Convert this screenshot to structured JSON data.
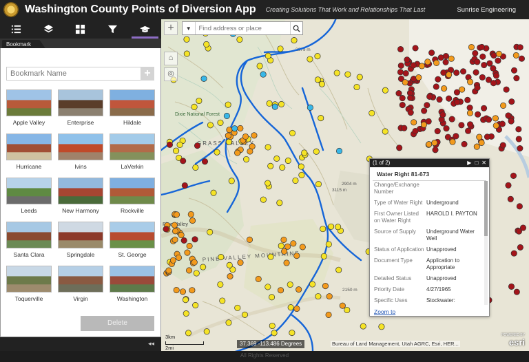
{
  "header": {
    "title": "Washington County Points of Diversion App",
    "tagline": "Creating Solutions That Work and Relationships That Last",
    "company": "Sunrise Engineering"
  },
  "toolbar": {
    "tools": [
      {
        "name": "legend-tool",
        "icon": "list-icon"
      },
      {
        "name": "layers-tool",
        "icon": "layers-icon"
      },
      {
        "name": "basemap-tool",
        "icon": "grid-icon"
      },
      {
        "name": "filter-tool",
        "icon": "filter-icon"
      },
      {
        "name": "bookmark-tool",
        "icon": "graduation-cap-icon",
        "active": true
      }
    ]
  },
  "panel": {
    "tab_label": "Bookmark",
    "input_placeholder": "Bookmark Name",
    "add_label": "+",
    "delete_label": "Delete",
    "collapse_label": "◂◂",
    "bookmarks": [
      {
        "label": "Apple Valley",
        "colors": [
          "#9fc3e6",
          "#b85a3a",
          "#6b7b3a"
        ]
      },
      {
        "label": "Enterprise",
        "colors": [
          "#a8c4dc",
          "#5a3d2a",
          "#8b8070"
        ]
      },
      {
        "label": "Hildale",
        "colors": [
          "#7fb0e0",
          "#c0563c",
          "#8a6b4a"
        ]
      },
      {
        "label": "Hurricane",
        "colors": [
          "#86b6e6",
          "#a14f35",
          "#cfc2a1"
        ]
      },
      {
        "label": "Ivins",
        "colors": [
          "#8fc1ea",
          "#c04a2a",
          "#a0826a"
        ]
      },
      {
        "label": "LaVerkin",
        "colors": [
          "#a3cbe9",
          "#b26b49",
          "#84915c"
        ]
      },
      {
        "label": "Leeds",
        "colors": [
          "#b7d3ea",
          "#5f8a43",
          "#6c6c6c"
        ]
      },
      {
        "label": "New Harmony",
        "colors": [
          "#93b9dd",
          "#a74532",
          "#4a6a3a"
        ]
      },
      {
        "label": "Rockville",
        "colors": [
          "#7fafe0",
          "#b05a38",
          "#6f8a4a"
        ]
      },
      {
        "label": "Santa Clara",
        "colors": [
          "#a6c8e4",
          "#8a4a30",
          "#6b8a55"
        ]
      },
      {
        "label": "Springdale",
        "colors": [
          "#cfd9e3",
          "#8c3a2a",
          "#9a8a6a"
        ]
      },
      {
        "label": "St. George",
        "colors": [
          "#a9cce8",
          "#b84c30",
          "#6a9048"
        ]
      },
      {
        "label": "Toquerville",
        "colors": [
          "#c8d8e6",
          "#6d7a4a",
          "#9d8b6d"
        ]
      },
      {
        "label": "Virgin",
        "colors": [
          "#b5cfe6",
          "#8a5a42",
          "#6e6e5a"
        ]
      },
      {
        "label": "Washington",
        "colors": [
          "#9bc2e6",
          "#9a4a3a",
          "#5e7a4a"
        ]
      }
    ]
  },
  "map": {
    "search_placeholder": "Find address or place",
    "zoom_in_label": "+",
    "coords": "37.369 -113.486 Degrees",
    "scale_label": "2mi",
    "scale_label_2": "3km",
    "attribution": "Bureau of Land Management, Utah AGRC, Esri, HER...",
    "esri_label": "esri",
    "esri_small": "POWERED BY",
    "place_labels": [
      {
        "text": "GRASS VALLEY"
      },
      {
        "text": "PINE VALLEY MOUNTAINS"
      },
      {
        "text": "Pine Valley"
      },
      {
        "text": "Dixie National Forest"
      },
      {
        "text": "2904 m"
      },
      {
        "text": "2150 m"
      },
      {
        "text": "3115 m"
      },
      {
        "text": "2679 m"
      }
    ]
  },
  "popup": {
    "counter": "(1 of 2)",
    "title": "Water Right 81-673",
    "zoom_label": "Zoom to",
    "attributes": [
      {
        "key": "Change/Exchange Number",
        "value": ""
      },
      {
        "key": "Type of Water Right",
        "value": "Underground"
      },
      {
        "key": "First Owner Listed on Water Right",
        "value": "HAROLD I. PAYTON"
      },
      {
        "key": "Source of Supply",
        "value": "Underground Water Well"
      },
      {
        "key": "Status of Application",
        "value": "Unapproved"
      },
      {
        "key": "Document Type",
        "value": "Application to Appropriate"
      },
      {
        "key": "Detailed Status",
        "value": "Unapproved"
      },
      {
        "key": "Priority Date",
        "value": "4/27/1965"
      },
      {
        "key": "Specific Uses",
        "value": "Stockwater:"
      }
    ]
  },
  "footer": {
    "text": "All Rights Reserved"
  },
  "colors": {
    "yellow_point": "#f5e326",
    "orange_point": "#f39a1c",
    "red_point": "#a3141a",
    "cyan_point": "#38b7e8",
    "river": "#1565d8",
    "accent": "#8d6cc4"
  }
}
